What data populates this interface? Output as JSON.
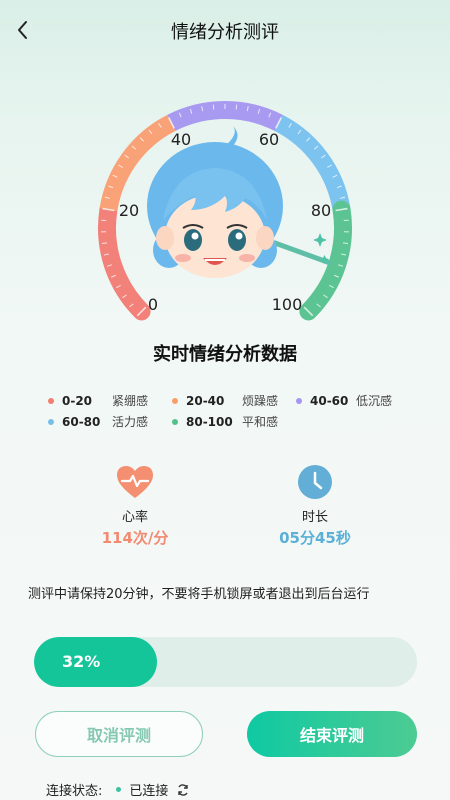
{
  "header": {
    "title": "情绪分析测评"
  },
  "gauge": {
    "ticks": [
      "0",
      "20",
      "40",
      "60",
      "80",
      "100"
    ],
    "segment_colors": [
      "#f2817a",
      "#f9a277",
      "#a89af0",
      "#7dc3ef",
      "#5cc493"
    ]
  },
  "section_title": "实时情绪分析数据",
  "legend": [
    {
      "range": "0-20",
      "name": "紧绷感",
      "color": "#f27e70"
    },
    {
      "range": "20-40",
      "name": "烦躁感",
      "color": "#f7a06a"
    },
    {
      "range": "40-60",
      "name": "低沉感",
      "color": "#a596ef"
    },
    {
      "range": "60-80",
      "name": "活力感",
      "color": "#77bfe9"
    },
    {
      "range": "80-100",
      "name": "平和感",
      "color": "#52c286"
    }
  ],
  "metrics": {
    "heart": {
      "label": "心率",
      "value_num": "114",
      "value_unit": "次/分"
    },
    "duration": {
      "label": "时长",
      "value": "05分45秒"
    }
  },
  "notice": "测评中请保持20分钟，不要将手机锁屏或者退出到后台运行",
  "progress": {
    "value": 0.32,
    "label": "32%"
  },
  "buttons": {
    "cancel": "取消评测",
    "end": "结束评测"
  },
  "status": {
    "label": "连接状态:",
    "value": "已连接"
  }
}
